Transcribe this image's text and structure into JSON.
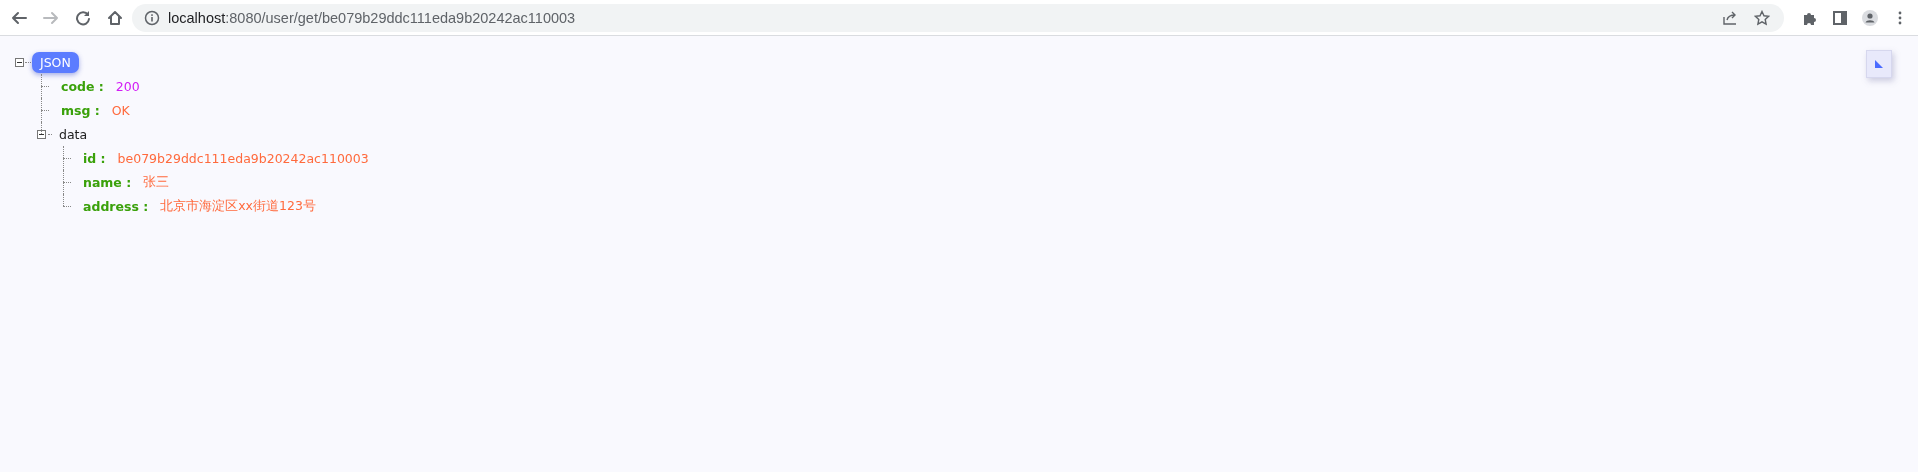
{
  "browser": {
    "nav_buttons": [
      {
        "kind": "back",
        "disabled": false
      },
      {
        "kind": "forward",
        "disabled": true
      },
      {
        "kind": "reload",
        "disabled": false
      },
      {
        "kind": "home",
        "disabled": false
      }
    ],
    "address": {
      "host": "localhost",
      "path": ":8080/user/get/be079b29ddc111eda9b20242ac110003"
    },
    "address_actions": [
      {
        "kind": "share"
      },
      {
        "kind": "star"
      }
    ],
    "toolbar_actions": [
      {
        "kind": "extensions"
      },
      {
        "kind": "side-panel"
      },
      {
        "kind": "profile"
      },
      {
        "kind": "menu"
      }
    ]
  },
  "viewer": {
    "root": {
      "label": "JSON",
      "expanded": true,
      "children": [
        {
          "key": "code :",
          "kind": "number",
          "value": "200"
        },
        {
          "key": "msg :",
          "kind": "string",
          "value": "OK"
        },
        {
          "key": "data",
          "kind": "object",
          "expanded": true,
          "children": [
            {
              "key": "id :",
              "kind": "string",
              "value": "be079b29ddc111eda9b20242ac110003"
            },
            {
              "key": "name :",
              "kind": "string",
              "value": "张三"
            },
            {
              "key": "address :",
              "kind": "string",
              "value": "北京市海淀区xx街道123号"
            }
          ]
        }
      ]
    }
  }
}
